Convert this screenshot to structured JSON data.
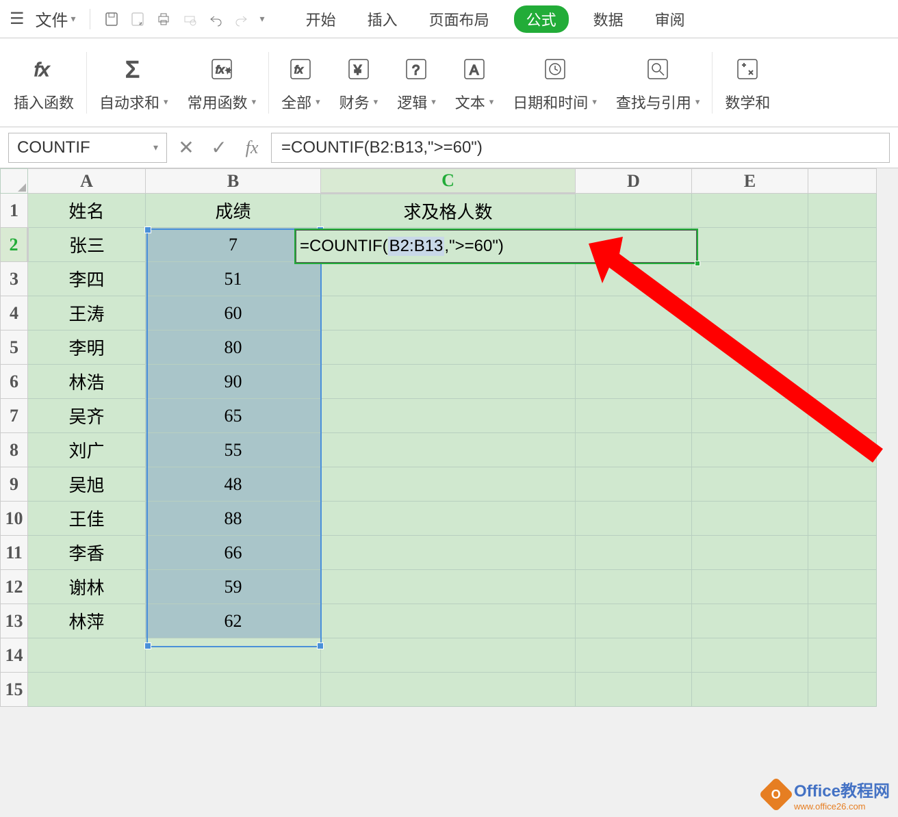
{
  "qat": {
    "file_label": "文件"
  },
  "tabs": {
    "items": [
      "开始",
      "插入",
      "页面布局",
      "公式",
      "数据",
      "审阅"
    ],
    "active_index": 3
  },
  "ribbon": {
    "insert_fn": "插入函数",
    "auto_sum": "自动求和",
    "common_fn": "常用函数",
    "all": "全部",
    "finance": "财务",
    "logic": "逻辑",
    "text": "文本",
    "datetime": "日期和时间",
    "lookup": "查找与引用",
    "math": "数学和"
  },
  "namebox": "COUNTIF",
  "formula": "=COUNTIF(B2:B13,\">=60\")",
  "edit_formula": {
    "prefix": "=COUNTIF(",
    "range": "B2:B13",
    "suffix": ",\">=60\")"
  },
  "grid": {
    "col_headers": [
      "A",
      "B",
      "C",
      "D",
      "E"
    ],
    "row_headers": [
      1,
      2,
      3,
      4,
      5,
      6,
      7,
      8,
      9,
      10,
      11,
      12,
      13,
      14,
      15
    ],
    "header_row": {
      "A": "姓名",
      "B": "成绩",
      "C": "求及格人数"
    },
    "rows": [
      {
        "name": "张三",
        "score": 7
      },
      {
        "name": "李四",
        "score": 51
      },
      {
        "name": "王涛",
        "score": 60
      },
      {
        "name": "李明",
        "score": 80
      },
      {
        "name": "林浩",
        "score": 90
      },
      {
        "name": "吴齐",
        "score": 65
      },
      {
        "name": "刘广",
        "score": 55
      },
      {
        "name": "吴旭",
        "score": 48
      },
      {
        "name": "王佳",
        "score": 88
      },
      {
        "name": "李香",
        "score": 66
      },
      {
        "name": "谢林",
        "score": 59
      },
      {
        "name": "林萍",
        "score": 62
      }
    ]
  },
  "watermark": {
    "title": "Office教程网",
    "url": "www.office26.com"
  }
}
